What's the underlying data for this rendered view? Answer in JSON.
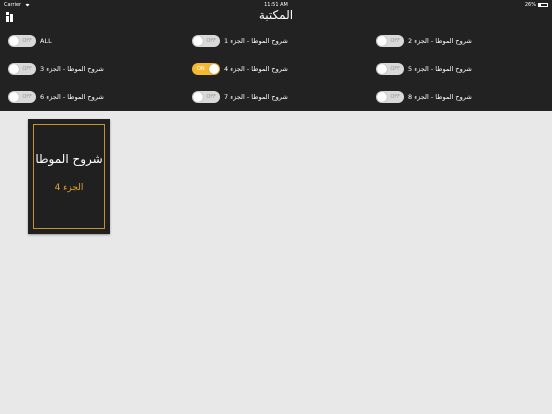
{
  "status_bar": {
    "carrier": "Carrier",
    "time": "11:51 AM",
    "battery": "26%",
    "wifi_icon": "wifi-icon",
    "battery_icon": "battery-icon"
  },
  "header": {
    "title": "المكتبة",
    "menu_icon": "library-menu-icon"
  },
  "toggle_off_label": "OFF",
  "toggle_on_label": "ON",
  "colors": {
    "background": "#e8e8e8",
    "topbar": "#222222",
    "toggle_on": "#f5b82e",
    "toggle_off": "#d9d9d9",
    "book_cover": "#202020",
    "book_accent": "#e3a52a"
  },
  "filters": [
    {
      "label": "ALL",
      "on": false
    },
    {
      "label": "شروح الموطا - الجزء 1",
      "on": false
    },
    {
      "label": "شروح الموطا - الجزء 2",
      "on": false
    },
    {
      "label": "شروح الموطا - الجزء 3",
      "on": false
    },
    {
      "label": "شروح الموطا - الجزء 4",
      "on": true
    },
    {
      "label": "شروح الموطا - الجزء 5",
      "on": false
    },
    {
      "label": "شروح الموطا - الجزء 6",
      "on": false
    },
    {
      "label": "شروح الموطا - الجزء 7",
      "on": false
    },
    {
      "label": "شروح الموطا - الجزء 8",
      "on": false
    }
  ],
  "books": [
    {
      "title": "شروح الموطا",
      "subtitle": "الجزء 4"
    }
  ]
}
